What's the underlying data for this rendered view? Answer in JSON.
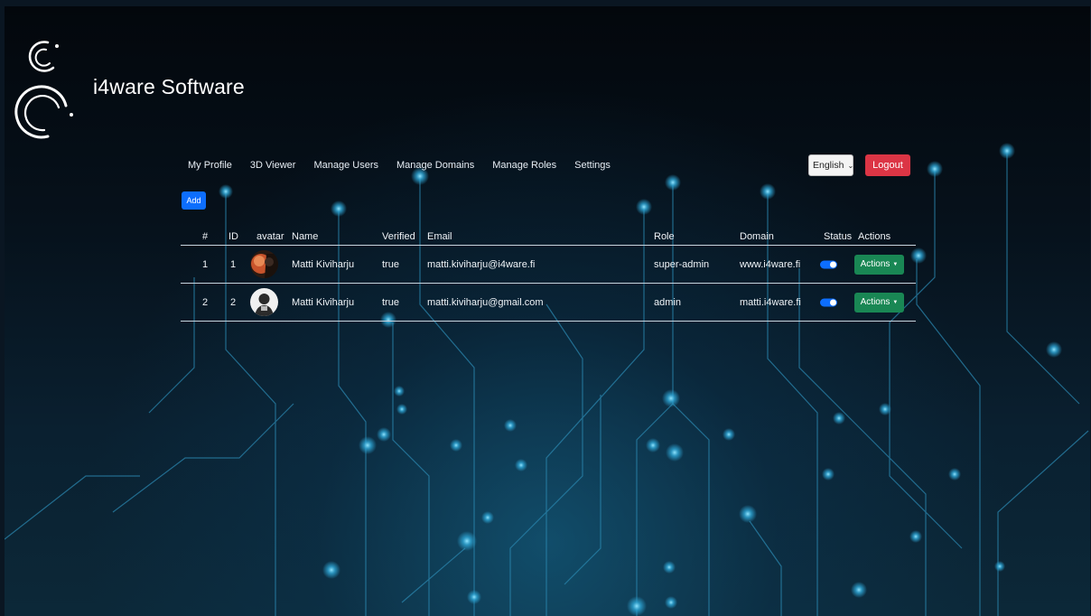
{
  "brand": {
    "name": "i4ware Software"
  },
  "nav": {
    "items": [
      "My Profile",
      "3D Viewer",
      "Manage Users",
      "Manage Domains",
      "Manage Roles",
      "Settings"
    ]
  },
  "language": {
    "selected": "English"
  },
  "logout_label": "Logout",
  "add_label": "Add",
  "table": {
    "headers": [
      "#",
      "ID",
      "avatar",
      "Name",
      "Verified",
      "Email",
      "Role",
      "Domain",
      "Status",
      "Actions"
    ],
    "rows": [
      {
        "num": "1",
        "id": "1",
        "name": "Matti Kiviharju",
        "verified": "true",
        "email": "matti.kiviharju@i4ware.fi",
        "role": "super-admin",
        "domain": "www.i4ware.fi",
        "status": true,
        "action": "Actions"
      },
      {
        "num": "2",
        "id": "2",
        "name": "Matti Kiviharju",
        "verified": "true",
        "email": "matti.kiviharju@gmail.com",
        "role": "admin",
        "domain": "matti.i4ware.fi",
        "status": true,
        "action": "Actions"
      }
    ]
  },
  "colors": {
    "add_button": "#0d6efd",
    "logout_button": "#dc3545",
    "actions_button": "#198754",
    "toggle_on": "#0d6efd",
    "circuit_glow": "#3fb6e8"
  }
}
